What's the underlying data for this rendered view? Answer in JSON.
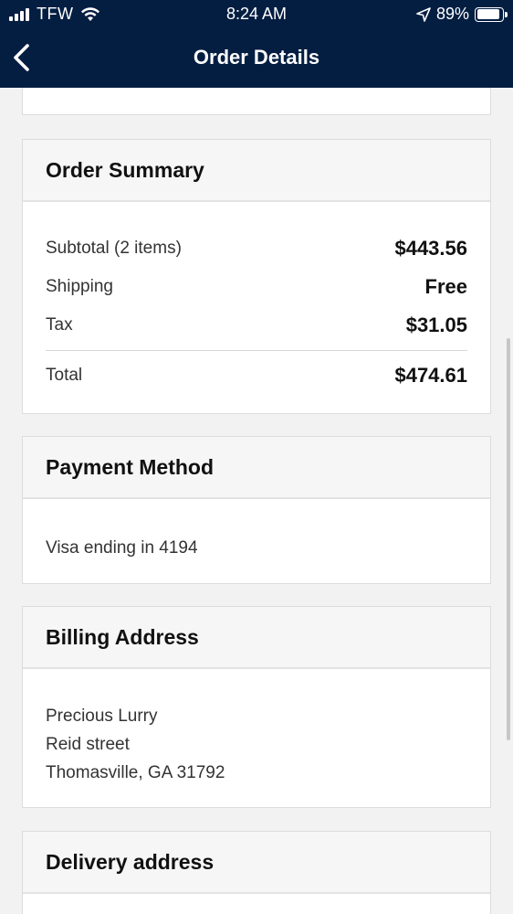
{
  "status_bar": {
    "carrier": "TFW",
    "time": "8:24 AM",
    "battery_percent": "89%",
    "battery_level": 0.89
  },
  "nav": {
    "title": "Order Details",
    "back_icon": "chevron-left-icon"
  },
  "order_summary": {
    "title": "Order Summary",
    "rows": [
      {
        "label": "Subtotal (2 items)",
        "value": "$443.56"
      },
      {
        "label": "Shipping",
        "value": "Free"
      },
      {
        "label": "Tax",
        "value": "$31.05"
      }
    ],
    "total_label": "Total",
    "total_value": "$474.61"
  },
  "payment_method": {
    "title": "Payment Method",
    "text": "Visa ending in 4194"
  },
  "billing_address": {
    "title": "Billing Address",
    "lines": [
      "Precious Lurry",
      "Reid street",
      "Thomasville, GA 31792"
    ]
  },
  "delivery_address": {
    "title": "Delivery address"
  },
  "colors": {
    "header_bg": "#041e42",
    "page_bg": "#f2f2f2"
  }
}
